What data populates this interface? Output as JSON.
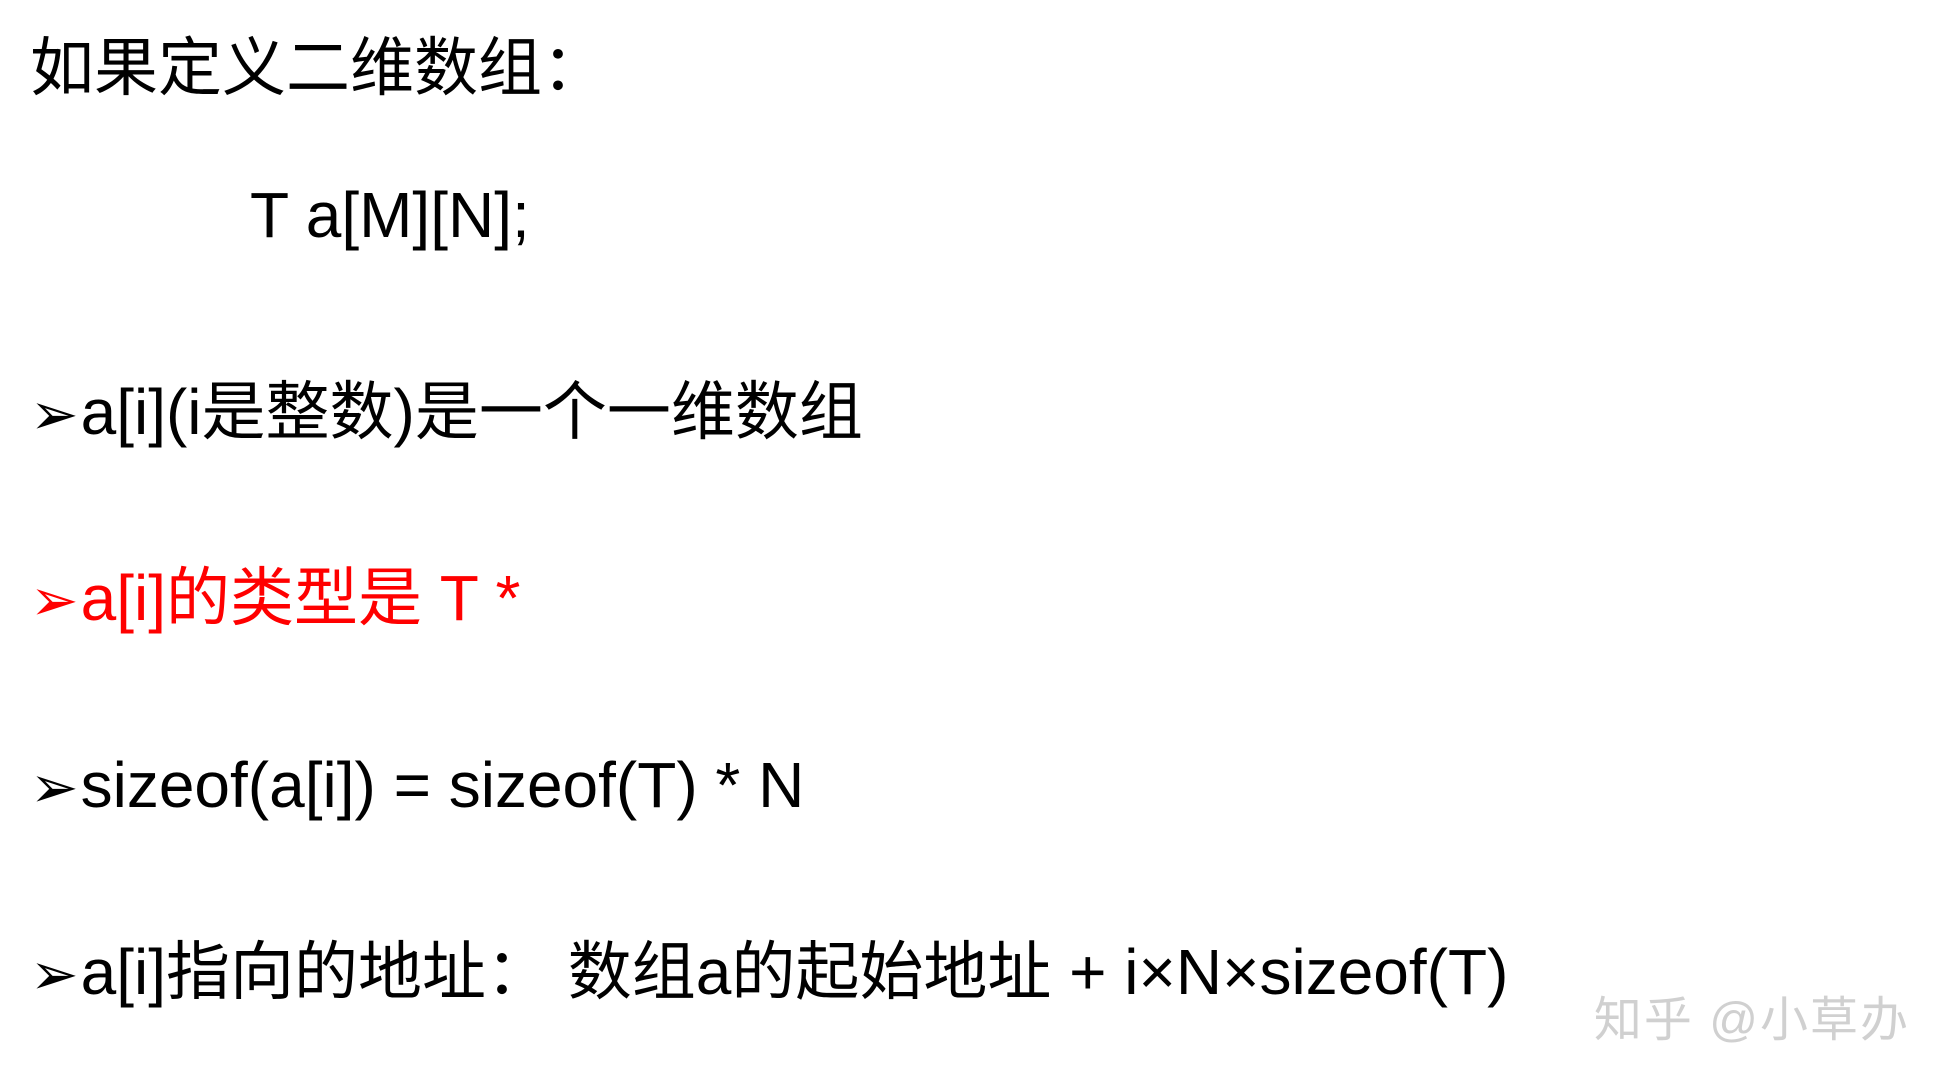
{
  "heading": "如果定义二维数组：",
  "code_line": "T a[M][N];",
  "bullets": [
    {
      "text": "a[i](i是整数)是一个一维数组",
      "red": false,
      "arrow_black": true
    },
    {
      "text": "a[i]的类型是 T *",
      "red": true,
      "arrow_black": false
    },
    {
      "text": "sizeof(a[i]) = sizeof(T) * N",
      "red": false,
      "arrow_black": true
    },
    {
      "text": "a[i]指向的地址： 数组a的起始地址 + i×N×sizeof(T)",
      "red": false,
      "arrow_black": true
    }
  ],
  "watermark": "知乎 @小草办",
  "arrow_glyph": "➢"
}
